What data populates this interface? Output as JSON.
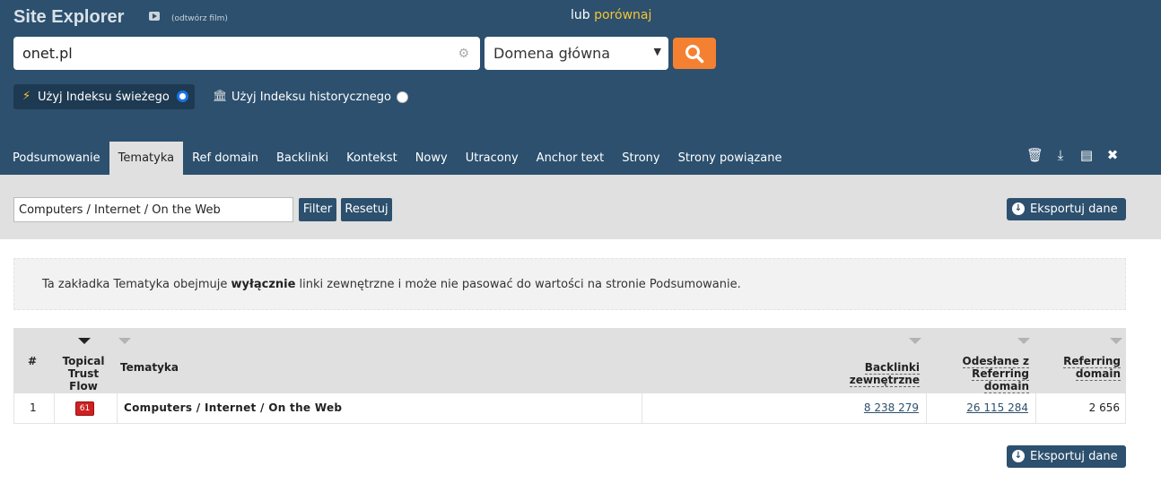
{
  "header": {
    "title": "Site Explorer",
    "film_link": "(odtwórz film)",
    "compare_prefix": "lub",
    "compare_link": "porównaj",
    "search_value": "onet.pl",
    "mode_select": "Domena główna",
    "index_fresh_label": "Użyj Indeksu świeżego",
    "index_historic_label": "Użyj Indeksu historycznego"
  },
  "tabs": [
    {
      "label": "Podsumowanie"
    },
    {
      "label": "Tematyka"
    },
    {
      "label": "Ref domain"
    },
    {
      "label": "Backlinki"
    },
    {
      "label": "Kontekst"
    },
    {
      "label": "Nowy"
    },
    {
      "label": "Utracony"
    },
    {
      "label": "Anchor text"
    },
    {
      "label": "Strony"
    },
    {
      "label": "Strony powiązane"
    }
  ],
  "filter": {
    "value": "Computers / Internet / On the Web",
    "filter_button": "Filter",
    "reset_button": "Resetuj",
    "export_button": "Eksportuj dane"
  },
  "notice": {
    "before": "Ta zakładka Tematyka obejmuje ",
    "bold": "wyłącznie",
    "after": " linki zewnętrzne i może nie pasować do wartości na stronie Podsumowanie."
  },
  "table": {
    "headers": {
      "num": "#",
      "ttf": "Topical Trust Flow",
      "topic": "Tematyka",
      "backlinks": "Backlinki zewnętrzne",
      "referred": "Odesłane z Referring domain",
      "refdomains": "Referring domain"
    },
    "rows": [
      {
        "num": "1",
        "ttf": "61",
        "topic": "Computers / Internet / On the Web",
        "backlinks": "8 238 279",
        "referred": "26 115 284",
        "refdomains": "2 656"
      }
    ]
  },
  "colors": {
    "header_bg": "#2c506e",
    "accent_orange": "#f48132",
    "link_yellow": "#f6c432",
    "badge_red": "#cc2222"
  }
}
